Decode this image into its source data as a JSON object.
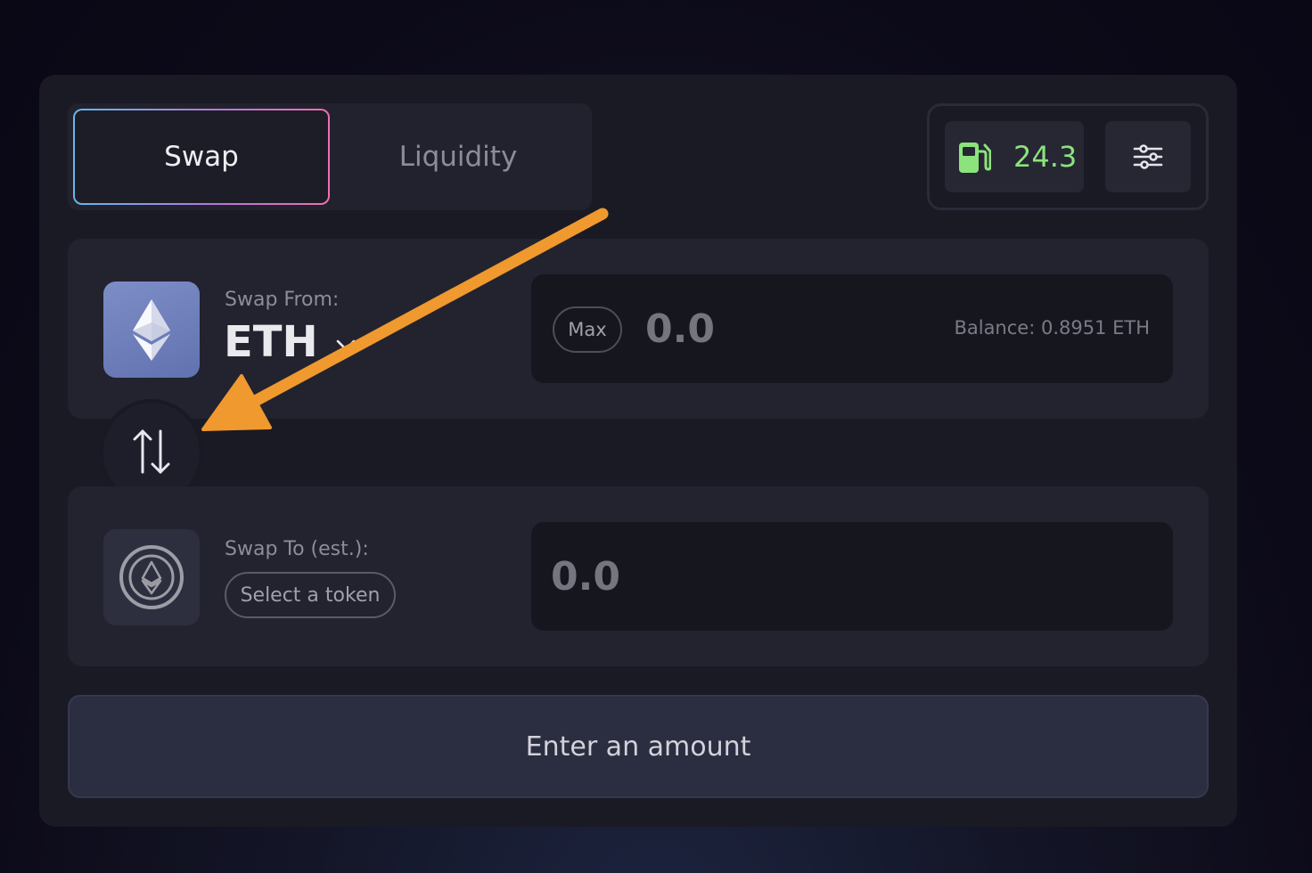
{
  "tabs": [
    {
      "label": "Swap",
      "active": true
    },
    {
      "label": "Liquidity",
      "active": false
    }
  ],
  "gas": {
    "icon": "fuel-pump-icon",
    "value": "24.3",
    "color": "#8ce37b"
  },
  "settings": {
    "icon": "sliders-icon"
  },
  "swap_from": {
    "label": "Swap From:",
    "token": "ETH",
    "token_icon": "ethereum-icon",
    "max_label": "Max",
    "amount_placeholder": "0.0",
    "balance": "Balance: 0.8951 ETH"
  },
  "swap_direction": {
    "icon": "swap-arrows-icon"
  },
  "swap_to": {
    "label": "Swap To (est.):",
    "token_icon": "ethereum-placeholder-icon",
    "select_label": "Select a token",
    "amount_placeholder": "0.0"
  },
  "submit": {
    "label": "Enter an amount"
  },
  "annotation": {
    "icon": "orange-arrow-annotation",
    "color": "#f0992e"
  },
  "theme": {
    "accent_gradient": [
      "#64b8ea",
      "#f06fae"
    ],
    "card_bg": "#1a1a25",
    "panel_bg": "#23232f"
  }
}
